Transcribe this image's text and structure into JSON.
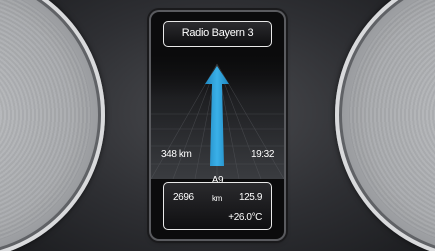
{
  "radio": {
    "station": "Radio Bayern 3"
  },
  "navigation": {
    "distance": "348 km",
    "time": "19:32",
    "road": "A9",
    "arrow_color": "#2a9fd8",
    "direction_icon": "straight-ahead-arrow-icon"
  },
  "trip_info": {
    "odometer": "2696",
    "odometer_unit": "km",
    "trip": "125.9",
    "temperature": "+26.0°C"
  }
}
